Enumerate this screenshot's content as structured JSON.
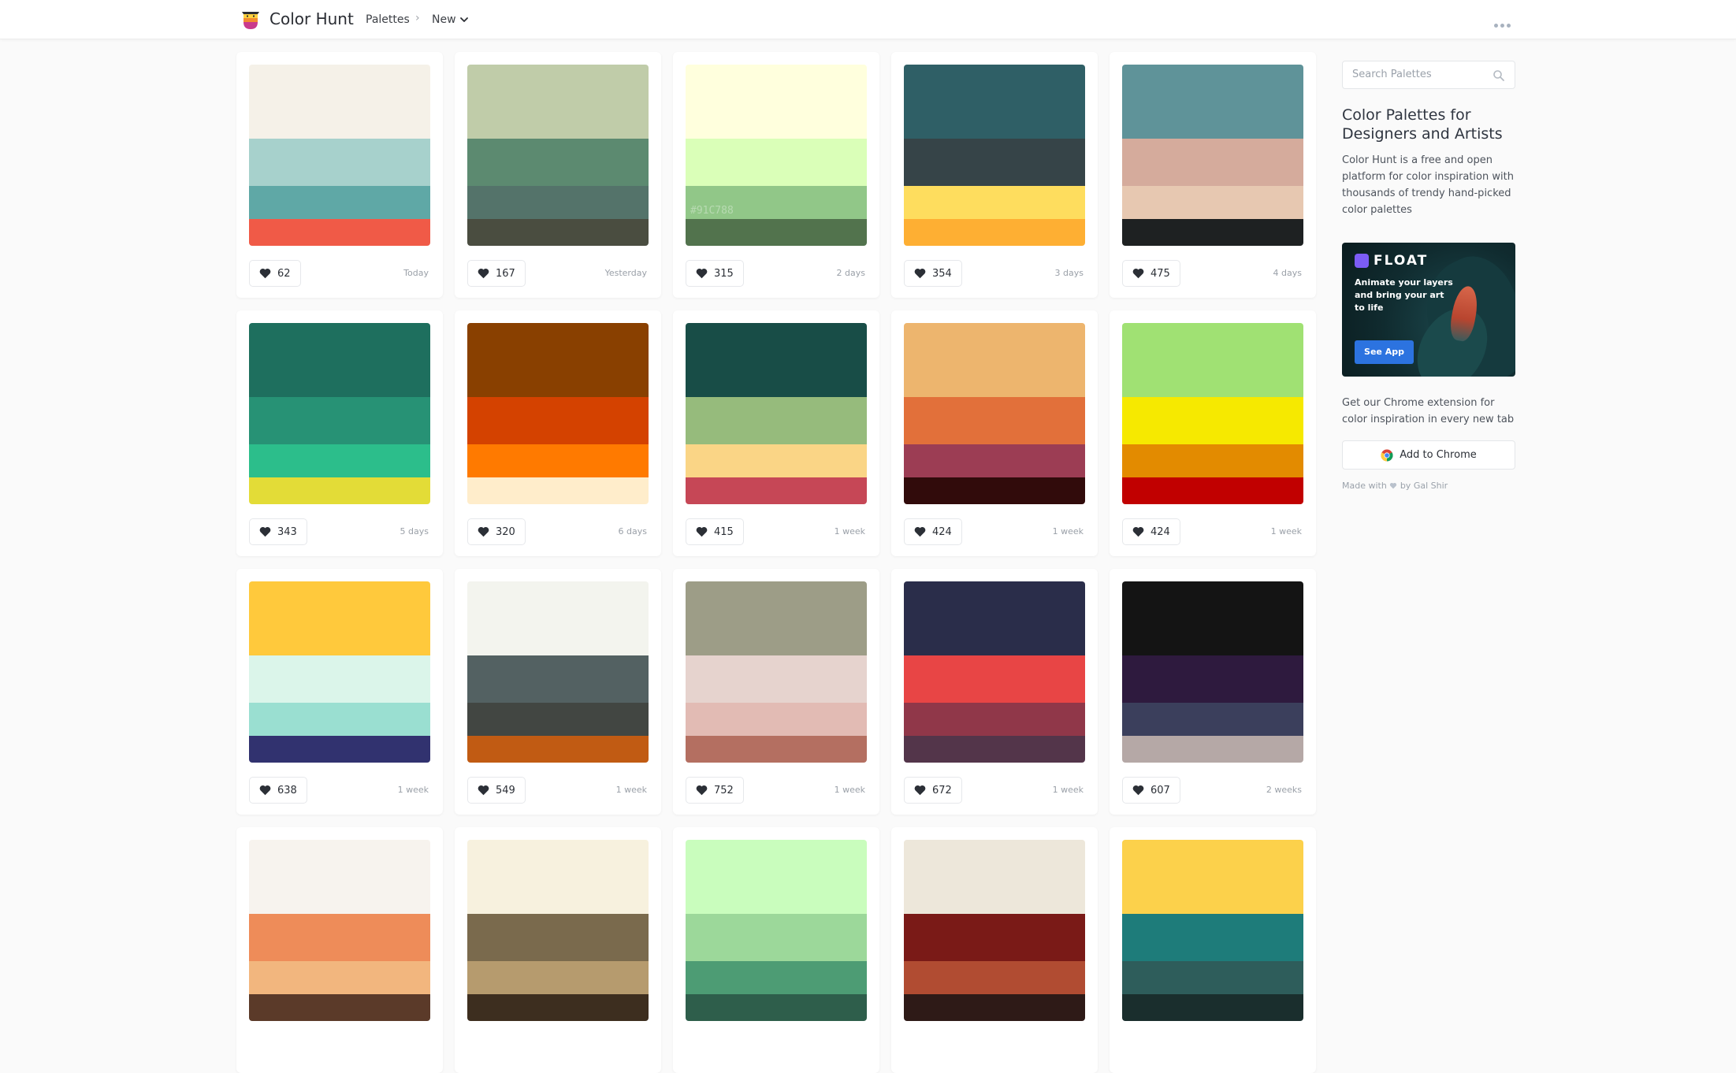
{
  "header": {
    "brand": "Color Hunt",
    "nav_palettes": "Palettes",
    "nav_separator": "›",
    "nav_new": "New"
  },
  "palettes": [
    {
      "colors": [
        "#F5F1E8",
        "#A7D1CC",
        "#5FA8A6",
        "#F05A47"
      ],
      "likes": "62",
      "date": "Today"
    },
    {
      "colors": [
        "#C0CCA9",
        "#5C8A70",
        "#54736A",
        "#4A4D40"
      ],
      "likes": "167",
      "date": "Yesterday"
    },
    {
      "colors": [
        "#FFFFDD",
        "#DAFFB8",
        "#91C788",
        "#52734D"
      ],
      "likes": "315",
      "date": "2 days",
      "hover_label": "#91C788"
    },
    {
      "colors": [
        "#2F5F66",
        "#364448",
        "#FEDD5E",
        "#FEAF33"
      ],
      "likes": "354",
      "date": "3 days"
    },
    {
      "colors": [
        "#5F9399",
        "#D5AB9C",
        "#E7C8B1",
        "#1E2122"
      ],
      "likes": "475",
      "date": "4 days"
    },
    {
      "colors": [
        "#1E6F5E",
        "#279275",
        "#2CBE8B",
        "#E3DC37"
      ],
      "likes": "343",
      "date": "5 days"
    },
    {
      "colors": [
        "#894000",
        "#D44200",
        "#FF7A00",
        "#FFEDCB"
      ],
      "likes": "320",
      "date": "6 days"
    },
    {
      "colors": [
        "#184D47",
        "#96BB7C",
        "#FAD586",
        "#C64756"
      ],
      "likes": "415",
      "date": "1 week"
    },
    {
      "colors": [
        "#EDB56E",
        "#E2703A",
        "#9C3D54",
        "#310B0B"
      ],
      "likes": "424",
      "date": "1 week"
    },
    {
      "colors": [
        "#A0E173",
        "#F6E900",
        "#E38B00",
        "#C10000"
      ],
      "likes": "424",
      "date": "1 week"
    },
    {
      "colors": [
        "#FFC93C",
        "#DBF5EA",
        "#9ADFD1",
        "#31326F"
      ],
      "likes": "638",
      "date": "1 week"
    },
    {
      "colors": [
        "#F3F4EE",
        "#536162",
        "#424642",
        "#C15B13"
      ],
      "likes": "549",
      "date": "1 week"
    },
    {
      "colors": [
        "#9D9D87",
        "#E6D3CE",
        "#E2BBB4",
        "#B46F61"
      ],
      "likes": "752",
      "date": "1 week"
    },
    {
      "colors": [
        "#2A2D4A",
        "#E84545",
        "#903749",
        "#53354A"
      ],
      "likes": "672",
      "date": "1 week"
    },
    {
      "colors": [
        "#141414",
        "#2E1A3E",
        "#3B3F5C",
        "#B5A8A6"
      ],
      "likes": "607",
      "date": "2 weeks"
    },
    {
      "colors": [
        "#F7F3EE",
        "#EE8C59",
        "#F2B67E",
        "#5B3A29"
      ],
      "likes": "",
      "date": ""
    },
    {
      "colors": [
        "#F7F1DE",
        "#7A6A4D",
        "#B69B6E",
        "#3D2E1F"
      ],
      "likes": "",
      "date": ""
    },
    {
      "colors": [
        "#C9FDBD",
        "#9CD89A",
        "#4D9C74",
        "#2E5E4B"
      ],
      "likes": "",
      "date": ""
    },
    {
      "colors": [
        "#EDE7DA",
        "#7A1A17",
        "#B14C32",
        "#2E1A17"
      ],
      "likes": "",
      "date": ""
    },
    {
      "colors": [
        "#FCD14B",
        "#1E7C7A",
        "#2E5D5B",
        "#1A2E2D"
      ],
      "likes": "",
      "date": ""
    }
  ],
  "sidebar": {
    "search_placeholder": "Search Palettes",
    "title": "Color Palettes for Designers and Artists",
    "description": "Color Hunt is a free and open platform for color inspiration with thousands of trendy hand-picked color palettes",
    "ad": {
      "brand": "FLOAT",
      "text": "Animate your layers and bring your art to life",
      "cta": "See App"
    },
    "chrome_text": "Get our Chrome extension for color inspiration in every new tab",
    "chrome_button": "Add to Chrome",
    "made_with_prefix": "Made with",
    "made_with_suffix": "by Gal Shir"
  }
}
